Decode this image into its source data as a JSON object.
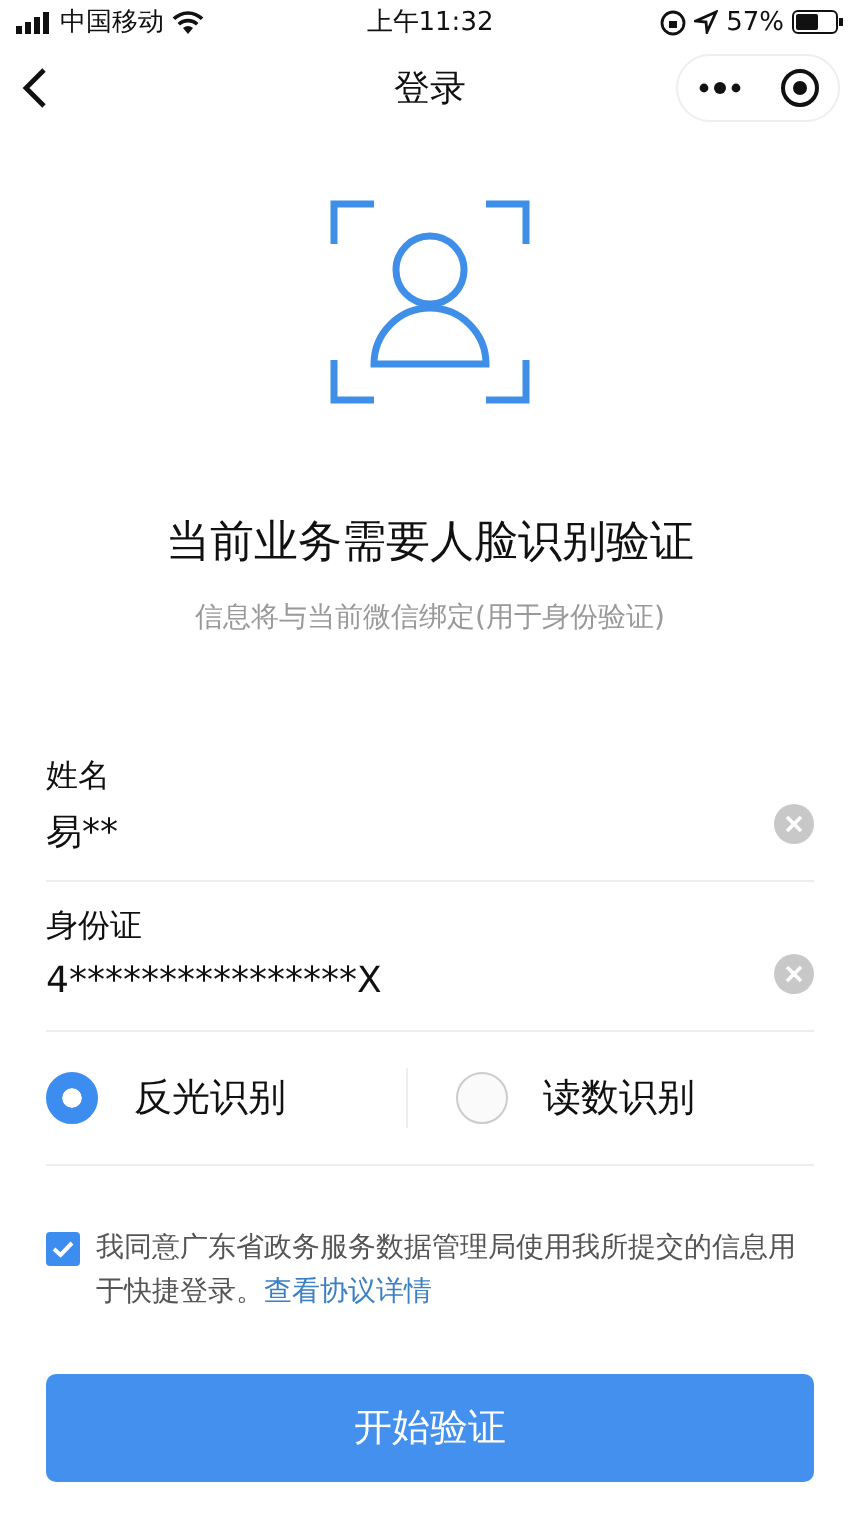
{
  "status_bar": {
    "carrier": "中国移动",
    "time": "上午11:32",
    "battery": "57%"
  },
  "nav": {
    "title": "登录"
  },
  "heading": "当前业务需要人脸识别验证",
  "subheading": "信息将与当前微信绑定(用于身份验证)",
  "fields": [
    {
      "label": "姓名",
      "value": "易**"
    },
    {
      "label": "身份证",
      "value": "4****************X"
    }
  ],
  "modes": [
    {
      "label": "反光识别",
      "selected": true
    },
    {
      "label": "读数识别",
      "selected": false
    }
  ],
  "agreement": {
    "checked": true,
    "text": "我同意广东省政务服务数据管理局使用我所提交的信息用于快捷登录。",
    "link": "查看协议详情"
  },
  "submit": "开始验证"
}
